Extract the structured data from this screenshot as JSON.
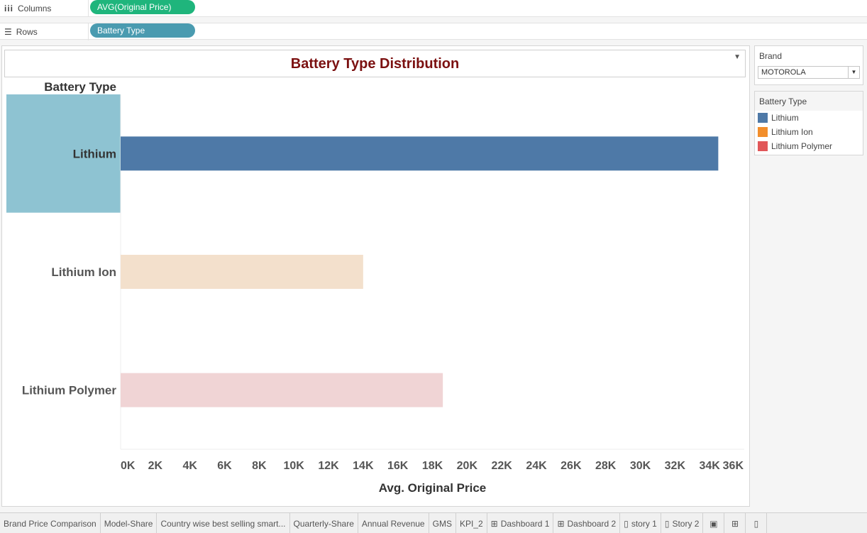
{
  "shelves": {
    "columns": {
      "label": "Columns",
      "pill": "AVG(Original Price)"
    },
    "rows": {
      "label": "Rows",
      "pill": "Battery Type"
    }
  },
  "title": "Battery Type Distribution",
  "filters": {
    "brand": {
      "title": "Brand",
      "value": "MOTOROLA"
    }
  },
  "legend": {
    "title": "Battery Type",
    "items": [
      {
        "label": "Lithium",
        "color": "#4e79a7"
      },
      {
        "label": "Lithium Ion",
        "color": "#f28e2b"
      },
      {
        "label": "Lithium Polymer",
        "color": "#e15759"
      }
    ]
  },
  "chart_data": {
    "type": "bar",
    "orientation": "horizontal",
    "row_header": "Battery Type",
    "categories": [
      "Lithium",
      "Lithium Ion",
      "Lithium Polymer"
    ],
    "values": [
      34500,
      14000,
      18600
    ],
    "colors": [
      "#4e79a7",
      "#f3e0cc",
      "#f0d4d5"
    ],
    "highlighted_category": "Lithium",
    "xlabel": "Avg. Original Price",
    "xlim": [
      0,
      36000
    ],
    "xticks": [
      "0K",
      "2K",
      "4K",
      "6K",
      "8K",
      "10K",
      "12K",
      "14K",
      "16K",
      "18K",
      "20K",
      "22K",
      "24K",
      "26K",
      "28K",
      "30K",
      "32K",
      "34K",
      "36K"
    ]
  },
  "tabs": [
    {
      "label": "Brand Price Comparison",
      "icon": ""
    },
    {
      "label": "Model-Share",
      "icon": ""
    },
    {
      "label": "Country wise best selling smart...",
      "icon": ""
    },
    {
      "label": "Quarterly-Share",
      "icon": ""
    },
    {
      "label": "Annual Revenue",
      "icon": ""
    },
    {
      "label": "GMS",
      "icon": ""
    },
    {
      "label": "KPI_2",
      "icon": ""
    },
    {
      "label": "Dashboard 1",
      "icon": "dashboard-icon"
    },
    {
      "label": "Dashboard 2",
      "icon": "dashboard-icon"
    },
    {
      "label": "story 1",
      "icon": "story-icon"
    },
    {
      "label": "Story 2",
      "icon": "story-icon"
    }
  ]
}
